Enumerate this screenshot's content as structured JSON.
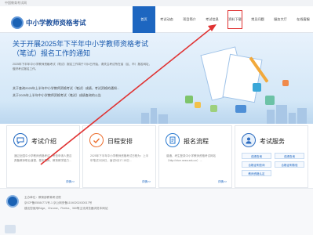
{
  "top_strip": {
    "text": "中国教育考试网"
  },
  "header": {
    "site_title": "中小学教师资格考试",
    "nav": [
      {
        "label": "首页",
        "active": true
      },
      {
        "label": "考试动态"
      },
      {
        "label": "项目简介"
      },
      {
        "label": "考试信息"
      },
      {
        "label": "资料下载",
        "highlighted": true
      },
      {
        "label": "常见问题"
      },
      {
        "label": "服务大厅"
      },
      {
        "label": "在线客服"
      }
    ]
  },
  "banner": {
    "title": "关于开展2025年下半年中小学教师资格考试（笔试）报名工作的通知",
    "paragraph": "2025年下半年中小学教师资格考试（笔试）报名工作将于7月4日开始，请关注考试所在省（区、市）报名网址，做好考试报名工作。",
    "links": [
      "关于查询2025年上半年中小学教师资格考试（笔试）成绩，考试资格的通知...",
      "关于2025年上半年中小学教师资格考试（笔试）成绩查询的公告"
    ]
  },
  "cards": [
    {
      "title": "考试介绍",
      "text": "通过全国中小学教师资格考试，考查申请人是否具备教师职业道德、基本素养、教育教学能力...",
      "more": "详情>>"
    },
    {
      "title": "日程安排",
      "text": "2025年下半年中小学教师资格考试日程为：上半年笔试3月8日，面试5月17-18日...",
      "more": "详情>>"
    },
    {
      "title": "报名流程",
      "text": "普通、考生登录中小学教师资格考试网站（http://ntce.neea.edu.cn）...",
      "more": "详情>>"
    },
    {
      "title": "考试服务",
      "services": [
        "成绩查询",
        "成绩查询",
        "合格证明查询",
        "合格证明核验",
        "教师资格认定"
      ]
    }
  ],
  "footer": {
    "line1": "主办单位：教育部教育考试院",
    "line2": "京ICP备05084771号-1    京公网安备11040202430017号",
    "line3": "建议您使用Edge、Chrome、Firefox、360等主流浏览器浏览本网站"
  }
}
